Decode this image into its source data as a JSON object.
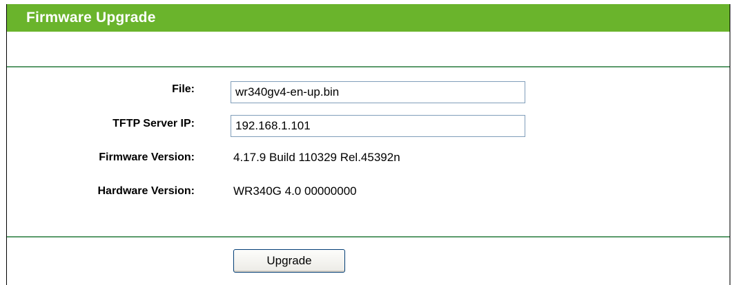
{
  "header": {
    "title": "Firmware Upgrade"
  },
  "form": {
    "file": {
      "label": "File:",
      "value": "wr340gv4-en-up.bin"
    },
    "tftp_server_ip": {
      "label": "TFTP Server IP:",
      "value": "192.168.1.101"
    },
    "firmware_version": {
      "label": "Firmware Version:",
      "value": "4.17.9 Build 110329 Rel.45392n"
    },
    "hardware_version": {
      "label": "Hardware Version:",
      "value": "WR340G 4.0 00000000"
    }
  },
  "actions": {
    "upgrade_label": "Upgrade"
  },
  "colors": {
    "title_bar": "#6ab42c",
    "divider": "#5a9a6a",
    "title_text": "#ffffff"
  }
}
